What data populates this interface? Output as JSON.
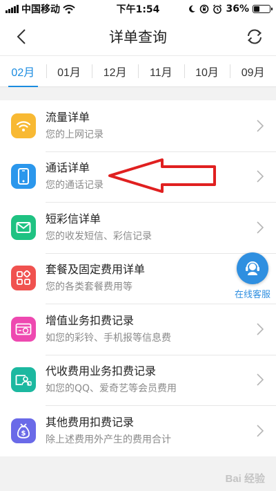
{
  "status_bar": {
    "carrier": "中国移动",
    "time": "下午1:54",
    "battery_text": "36%",
    "battery_level": 0.36
  },
  "nav": {
    "title": "详单查询",
    "back_icon": "chevron-left-icon",
    "refresh_icon": "refresh-icon"
  },
  "months": [
    {
      "label": "02月",
      "active": true
    },
    {
      "label": "01月",
      "active": false
    },
    {
      "label": "12月",
      "active": false
    },
    {
      "label": "11月",
      "active": false
    },
    {
      "label": "10月",
      "active": false
    },
    {
      "label": "09月",
      "active": false
    }
  ],
  "items": [
    {
      "title": "流量详单",
      "subtitle": "您的上网记录",
      "icon": "wifi-icon",
      "color": "#f8b933"
    },
    {
      "title": "通话详单",
      "subtitle": "您的通话记录",
      "icon": "phone-icon",
      "color": "#2b97ec"
    },
    {
      "title": "短彩信详单",
      "subtitle": "您的收发短信、彩信记录",
      "icon": "mail-icon",
      "color": "#1fc282"
    },
    {
      "title": "套餐及固定费用详单",
      "subtitle": "您的各类套餐费用等",
      "icon": "grid-icon",
      "color": "#f0524f"
    },
    {
      "title": "增值业务扣费记录",
      "subtitle": "如您的彩铃、手机报等信息费",
      "icon": "yuan-card-icon",
      "color": "#ee49b0"
    },
    {
      "title": "代收费用业务扣费记录",
      "subtitle": "如您的QQ、爱奇艺等会员费用",
      "icon": "user-card-icon",
      "color": "#1cb8a0"
    },
    {
      "title": "其他费用扣费记录",
      "subtitle": "除上述费用外产生的费用合计",
      "icon": "money-bag-icon",
      "color": "#6a6ae8"
    }
  ],
  "float_service": {
    "label": "在线客服"
  },
  "watermark": "Bai 经验",
  "colors": {
    "accent": "#1a8be0",
    "annotation": "#e02020"
  }
}
